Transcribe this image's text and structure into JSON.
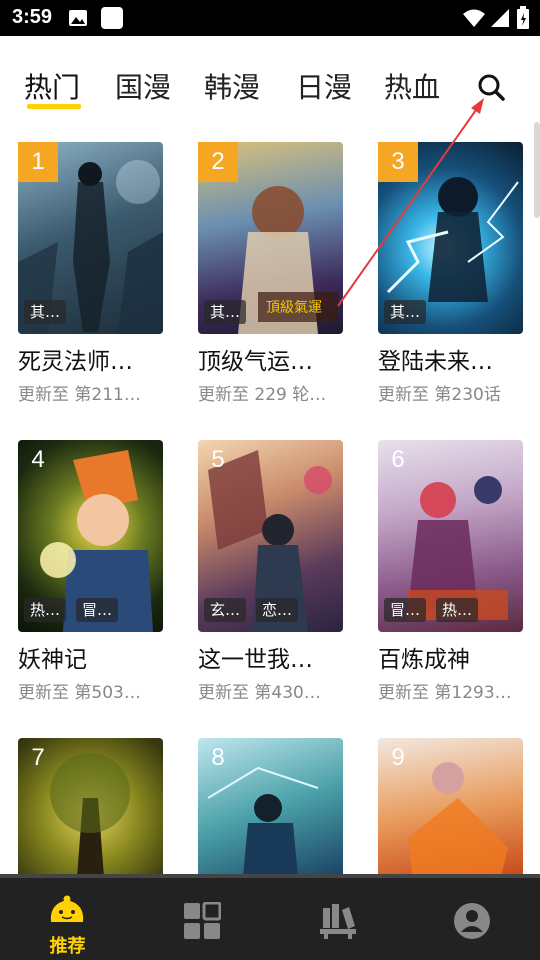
{
  "status_bar": {
    "time": "3:59"
  },
  "tabs": [
    {
      "label": "热门",
      "active": true
    },
    {
      "label": "国漫"
    },
    {
      "label": "韩漫"
    },
    {
      "label": "日漫"
    },
    {
      "label": "热血"
    }
  ],
  "comics": [
    {
      "rank": "1",
      "title": "死灵法师…",
      "update": "更新至 第211…",
      "tags": [
        "其…"
      ]
    },
    {
      "rank": "2",
      "title": "顶级气运…",
      "update": "更新至 229 轮…",
      "tags": [
        "其…"
      ]
    },
    {
      "rank": "3",
      "title": "登陆未来…",
      "update": "更新至 第230话",
      "tags": [
        "其…"
      ]
    },
    {
      "rank": "4",
      "title": "妖神记",
      "update": "更新至 第503…",
      "tags": [
        "热…",
        "冒…"
      ]
    },
    {
      "rank": "5",
      "title": "这一世我…",
      "update": "更新至 第430…",
      "tags": [
        "玄…",
        "恋…"
      ]
    },
    {
      "rank": "6",
      "title": "百炼成神",
      "update": "更新至 第1293…",
      "tags": [
        "冒…",
        "热…"
      ]
    },
    {
      "rank": "7"
    },
    {
      "rank": "8"
    },
    {
      "rank": "9"
    }
  ],
  "bottom_nav": {
    "recommend_label": "推荐"
  },
  "colors": {
    "accent": "#ffd200",
    "rank_badge": "#f5a623",
    "nav_bg": "#222222"
  }
}
